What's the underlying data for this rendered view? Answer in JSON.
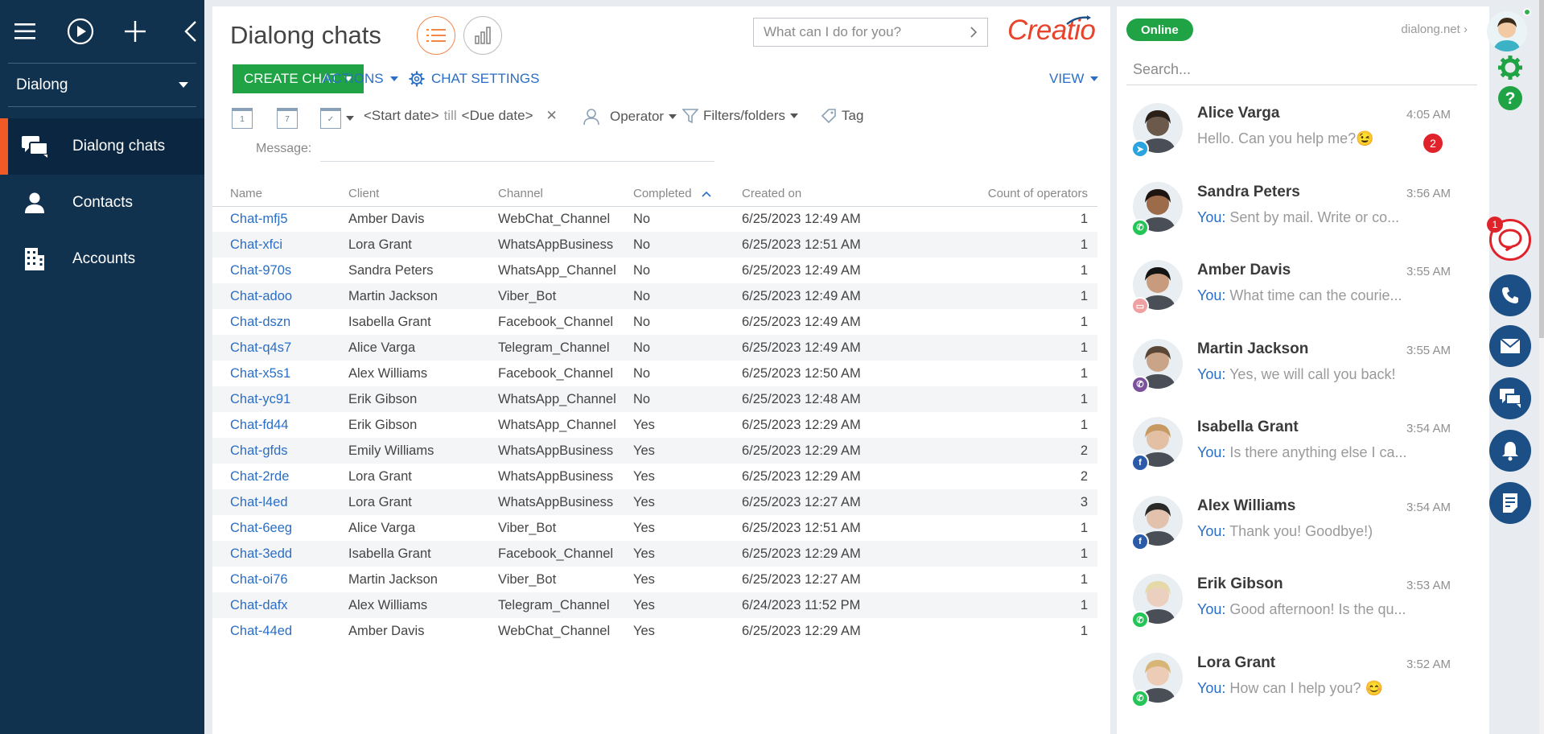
{
  "sidebar": {
    "workspace": "Dialong",
    "items": [
      {
        "label": "Dialong chats",
        "icon": "chats-icon",
        "active": true
      },
      {
        "label": "Contacts",
        "icon": "person-icon",
        "active": false
      },
      {
        "label": "Accounts",
        "icon": "building-icon",
        "active": false
      }
    ]
  },
  "main": {
    "title": "Dialong chats",
    "command_placeholder": "What can I do for you?",
    "logo": "Creatio",
    "toolbar": {
      "create": "CREATE CHAT",
      "actions": "ACTIONS",
      "settings": "CHAT SETTINGS",
      "view": "VIEW"
    },
    "filters": {
      "date_start": "<Start date>",
      "till": "till",
      "date_due": "<Due date>",
      "operator": "Operator",
      "folders": "Filters/folders",
      "tag": "Tag",
      "message_label": "Message:",
      "cal1": "1",
      "cal2": "7"
    },
    "columns": [
      "Name",
      "Client",
      "Channel",
      "Completed",
      "Created on",
      "Count of operators"
    ],
    "rows": [
      [
        "Chat-mfj5",
        "Amber Davis",
        "WebChat_Channel",
        "No",
        "6/25/2023 12:49 AM",
        "1"
      ],
      [
        "Chat-xfci",
        "Lora Grant",
        "WhatsAppBusiness",
        "No",
        "6/25/2023 12:51 AM",
        "1"
      ],
      [
        "Chat-970s",
        "Sandra Peters",
        "WhatsApp_Channel",
        "No",
        "6/25/2023 12:49 AM",
        "1"
      ],
      [
        "Chat-adoo",
        "Martin Jackson",
        "Viber_Bot",
        "No",
        "6/25/2023 12:49 AM",
        "1"
      ],
      [
        "Chat-dszn",
        "Isabella Grant",
        "Facebook_Channel",
        "No",
        "6/25/2023 12:49 AM",
        "1"
      ],
      [
        "Chat-q4s7",
        "Alice Varga",
        "Telegram_Channel",
        "No",
        "6/25/2023 12:49 AM",
        "1"
      ],
      [
        "Chat-x5s1",
        "Alex Williams",
        "Facebook_Channel",
        "No",
        "6/25/2023 12:50 AM",
        "1"
      ],
      [
        "Chat-yc91",
        "Erik Gibson",
        "WhatsApp_Channel",
        "No",
        "6/25/2023 12:48 AM",
        "1"
      ],
      [
        "Chat-fd44",
        "Erik Gibson",
        "WhatsApp_Channel",
        "Yes",
        "6/25/2023 12:29 AM",
        "1"
      ],
      [
        "Chat-gfds",
        "Emily Williams",
        "WhatsAppBusiness",
        "Yes",
        "6/25/2023 12:29 AM",
        "2"
      ],
      [
        "Chat-2rde",
        "Lora Grant",
        "WhatsAppBusiness",
        "Yes",
        "6/25/2023 12:29 AM",
        "2"
      ],
      [
        "Chat-l4ed",
        "Lora Grant",
        "WhatsAppBusiness",
        "Yes",
        "6/25/2023 12:27 AM",
        "3"
      ],
      [
        "Chat-6eeg",
        "Alice Varga",
        "Viber_Bot",
        "Yes",
        "6/25/2023 12:51 AM",
        "1"
      ],
      [
        "Chat-3edd",
        "Isabella Grant",
        "Facebook_Channel",
        "Yes",
        "6/25/2023 12:29 AM",
        "1"
      ],
      [
        "Chat-oi76",
        "Martin Jackson",
        "Viber_Bot",
        "Yes",
        "6/25/2023 12:27 AM",
        "1"
      ],
      [
        "Chat-dafx",
        "Alex Williams",
        "Telegram_Channel",
        "Yes",
        "6/24/2023 11:52 PM",
        "1"
      ],
      [
        "Chat-44ed",
        "Amber Davis",
        "WebChat_Channel",
        "Yes",
        "6/25/2023 12:29 AM",
        "1"
      ]
    ]
  },
  "chat_panel": {
    "status": "Online",
    "domain": "dialong.net",
    "search_placeholder": "Search...",
    "you_label": "You:",
    "chats": [
      {
        "name": "Alice Varga",
        "time": "4:05 AM",
        "you": false,
        "message": "Hello. Can you help me?😉",
        "unread": "2",
        "channel": "telegram",
        "skin": "#6b5a4b",
        "hair": "#2a2018"
      },
      {
        "name": "Sandra Peters",
        "time": "3:56 AM",
        "you": true,
        "message": "Sent by mail. Write or co...",
        "unread": "",
        "channel": "whatsapp",
        "skin": "#9c6b4a",
        "hair": "#1e1410"
      },
      {
        "name": "Amber Davis",
        "time": "3:55 AM",
        "you": true,
        "message": "What time can the courie...",
        "unread": "",
        "channel": "webchat",
        "skin": "#c89b7e",
        "hair": "#141414"
      },
      {
        "name": "Martin Jackson",
        "time": "3:55 AM",
        "you": true,
        "message": "Yes, we will call you back!",
        "unread": "",
        "channel": "viber",
        "skin": "#c9a488",
        "hair": "#5a4636"
      },
      {
        "name": "Isabella Grant",
        "time": "3:54 AM",
        "you": true,
        "message": "Is there anything else I ca...",
        "unread": "",
        "channel": "facebook",
        "skin": "#e3bfa3",
        "hair": "#c79a62"
      },
      {
        "name": "Alex Williams",
        "time": "3:54 AM",
        "you": true,
        "message": "Thank you! Goodbye!)",
        "unread": "",
        "channel": "facebook",
        "skin": "#e2c2ad",
        "hair": "#2a2a2a"
      },
      {
        "name": "Erik Gibson",
        "time": "3:53 AM",
        "you": true,
        "message": "Good afternoon! Is the qu...",
        "unread": "",
        "channel": "whatsapp",
        "skin": "#ecd0bf",
        "hair": "#e6d9a8"
      },
      {
        "name": "Lora Grant",
        "time": "3:52 AM",
        "you": true,
        "message": "How can I help you? 😊",
        "unread": "",
        "channel": "whatsapp",
        "skin": "#ecccb6",
        "hair": "#d6b577"
      }
    ]
  },
  "rail": {
    "notif_count": "1",
    "buttons": [
      "chat-icon",
      "phone-icon",
      "mail-icon",
      "comments-icon",
      "bell-icon",
      "document-icon"
    ]
  },
  "colors": {
    "sidebar": "#11324f",
    "accent_orange": "#f15a24",
    "green": "#1fa345",
    "link_blue": "#2a6ec7",
    "red": "#e0232b"
  }
}
